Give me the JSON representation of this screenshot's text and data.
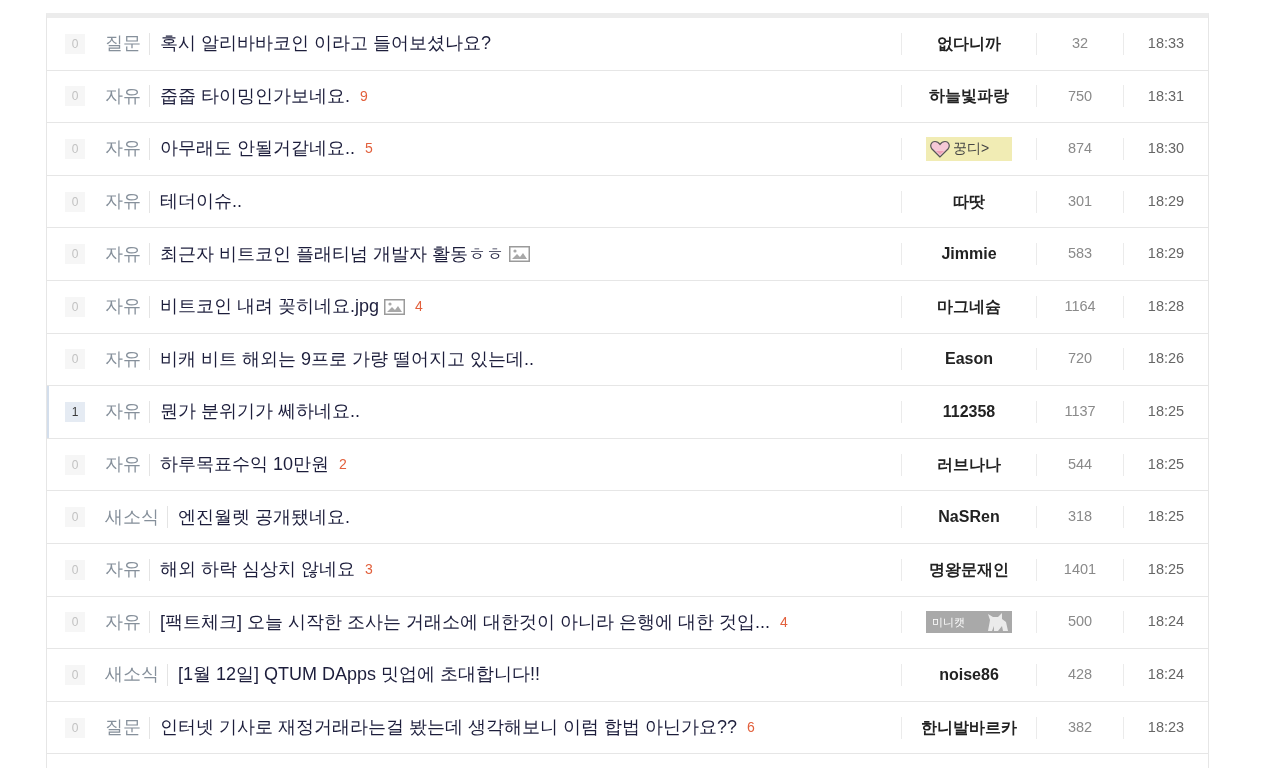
{
  "posts": [
    {
      "recommends": "0",
      "highlighted": false,
      "category": "질문",
      "title": "혹시 알리바바코인 이라고 들어보셨나요?",
      "has_image": false,
      "author": {
        "name": "없다니까",
        "kind": "plain"
      },
      "views": "32",
      "time": "18:33"
    },
    {
      "recommends": "0",
      "highlighted": false,
      "category": "자유",
      "title": "줍줍 타이밍인가보네요.",
      "has_image": false,
      "comments": "9",
      "author": {
        "name": "하늘빛파랑",
        "kind": "plain"
      },
      "views": "750",
      "time": "18:31"
    },
    {
      "recommends": "0",
      "highlighted": false,
      "category": "자유",
      "title": "아무래도 안될거같네요..",
      "has_image": false,
      "comments": "5",
      "author": {
        "name": "꿍디>",
        "kind": "heart",
        "color": "#f1ecb4"
      },
      "views": "874",
      "time": "18:30"
    },
    {
      "recommends": "0",
      "highlighted": false,
      "category": "자유",
      "title": "테더이슈..",
      "has_image": false,
      "author": {
        "name": "따땃",
        "kind": "plain"
      },
      "views": "301",
      "time": "18:29"
    },
    {
      "recommends": "0",
      "highlighted": false,
      "category": "자유",
      "title": "최근자 비트코인 플래티넘 개발자 활동ㅎㅎ",
      "has_image": true,
      "author": {
        "name": "Jimmie",
        "kind": "plain"
      },
      "views": "583",
      "time": "18:29"
    },
    {
      "recommends": "0",
      "highlighted": false,
      "category": "자유",
      "title": "비트코인 내려 꽂히네요.jpg",
      "has_image": true,
      "comments": "4",
      "author": {
        "name": "마그네슘",
        "kind": "plain"
      },
      "views": "1164",
      "time": "18:28"
    },
    {
      "recommends": "0",
      "highlighted": false,
      "category": "자유",
      "title": "비캐 비트 해외는 9프로 가량 떨어지고 있는데..",
      "has_image": false,
      "author": {
        "name": "Eason",
        "kind": "plain"
      },
      "views": "720",
      "time": "18:26"
    },
    {
      "recommends": "1",
      "highlighted": true,
      "category": "자유",
      "title": "뭔가 분위기가 쎄하네요..",
      "has_image": false,
      "author": {
        "name": "112358",
        "kind": "plain"
      },
      "views": "1137",
      "time": "18:25"
    },
    {
      "recommends": "0",
      "highlighted": false,
      "category": "자유",
      "title": "하루목표수익 10만원",
      "has_image": false,
      "comments": "2",
      "author": {
        "name": "러브나나",
        "kind": "plain"
      },
      "views": "544",
      "time": "18:25"
    },
    {
      "recommends": "0",
      "highlighted": false,
      "category": "새소식",
      "title": "엔진월렛 공개됐네요.",
      "has_image": false,
      "author": {
        "name": "NaSRen",
        "kind": "plain"
      },
      "views": "318",
      "time": "18:25"
    },
    {
      "recommends": "0",
      "highlighted": false,
      "category": "자유",
      "title": "해외 하락 심상치 않네요",
      "has_image": false,
      "comments": "3",
      "author": {
        "name": "명왕문재인",
        "kind": "plain"
      },
      "views": "1401",
      "time": "18:25"
    },
    {
      "recommends": "0",
      "highlighted": false,
      "category": "자유",
      "title": "[팩트체크] 오늘 시작한 조사는 거래소에 대한것이 아니라 은행에 대한 것입...",
      "has_image": false,
      "comments": "4",
      "author": {
        "name": "미니캣",
        "kind": "cat",
        "color": "#a9a9a9"
      },
      "views": "500",
      "time": "18:24"
    },
    {
      "recommends": "0",
      "highlighted": false,
      "category": "새소식",
      "title": "[1월 12일] QTUM DApps 밋업에 초대합니다!!",
      "has_image": false,
      "author": {
        "name": "noise86",
        "kind": "plain"
      },
      "views": "428",
      "time": "18:24"
    },
    {
      "recommends": "0",
      "highlighted": false,
      "category": "질문",
      "title": "인터넷 기사로 재정거래라는걸 봤는데 생각해보니 이럼 합법 아닌가요??",
      "has_image": false,
      "comments": "6",
      "author": {
        "name": "한니발바르카",
        "kind": "plain"
      },
      "views": "382",
      "time": "18:23"
    }
  ]
}
